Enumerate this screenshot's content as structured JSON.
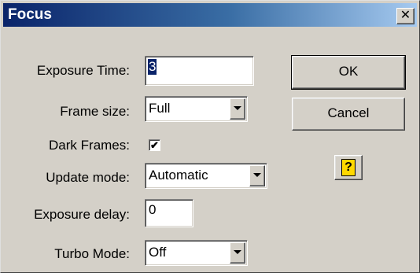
{
  "window": {
    "title": "Focus",
    "close_glyph": "✕"
  },
  "fields": {
    "exposure_time": {
      "label": "Exposure Time:",
      "value": "3"
    },
    "frame_size": {
      "label": "Frame size:",
      "value": "Full"
    },
    "dark_frames": {
      "label": "Dark Frames:",
      "checked": true,
      "check_glyph": "✔"
    },
    "update_mode": {
      "label": "Update mode:",
      "value": "Automatic"
    },
    "exposure_delay": {
      "label": "Exposure delay:",
      "value": "0"
    },
    "turbo_mode": {
      "label": "Turbo Mode:",
      "value": "Off"
    }
  },
  "buttons": {
    "ok": "OK",
    "cancel": "Cancel",
    "help_glyph": "?"
  },
  "colors": {
    "title_gradient_start": "#0a246a",
    "title_gradient_end": "#a6caf0",
    "help_icon": "#ffd800"
  }
}
